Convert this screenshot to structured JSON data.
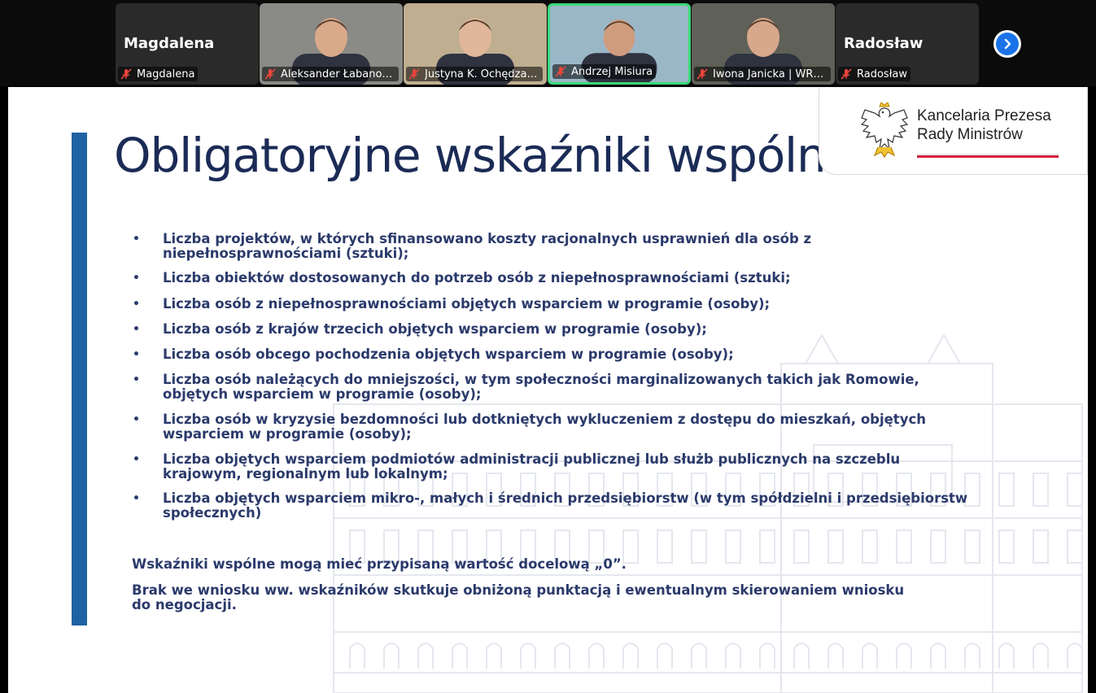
{
  "participants": [
    {
      "big_name": "Magdalena",
      "label": "Magdalena",
      "video": false,
      "active": false
    },
    {
      "big_name": "",
      "label": "Aleksander Łabanowsk...",
      "video": true,
      "active": false
    },
    {
      "big_name": "",
      "label": "Justyna K. Ochędzan W...",
      "video": true,
      "active": false
    },
    {
      "big_name": "",
      "label": "Andrzej Misiura",
      "video": true,
      "active": true
    },
    {
      "big_name": "",
      "label": "Iwona Janicka | WRZOS",
      "video": true,
      "active": false
    },
    {
      "big_name": "Radosław",
      "label": "Radosław",
      "video": false,
      "active": false
    }
  ],
  "icons": {
    "muted": "microphone-muted-icon",
    "next": "chevron-right-icon",
    "emblem": "polish-eagle-emblem-icon"
  },
  "slide": {
    "title": "Obligatoryjne wskaźniki wspólne",
    "logo_line1": "Kancelaria Prezesa",
    "logo_line2": "Rady Ministrów",
    "bullets": [
      "Liczba projektów, w których sfinansowano koszty racjonalnych usprawnień dla osób z niepełnosprawnościami (sztuki);",
      "Liczba obiektów dostosowanych do potrzeb osób z niepełnosprawnościami (sztuki;",
      "Liczba osób z niepełnosprawnościami objętych wsparciem w programie (osoby);",
      "Liczba osób z krajów trzecich objętych wsparciem w programie (osoby);",
      "Liczba osób obcego pochodzenia objętych wsparciem w programie (osoby);",
      "Liczba osób należących do mniejszości, w tym społeczności marginalizowanych takich jak Romowie, objętych wsparciem w programie (osoby);",
      "Liczba osób w kryzysie bezdomności lub dotkniętych wykluczeniem z dostępu do mieszkań, objętych wsparciem w programie (osoby);",
      "Liczba objętych wsparciem podmiotów administracji publicznej lub służb publicznych na szczeblu krajowym, regionalnym lub lokalnym;",
      "Liczba objętych wsparciem mikro-, małych i średnich przedsiębiorstw (w tym spółdzielni i przedsiębiorstw społecznych)"
    ],
    "note1": "Wskaźniki wspólne mogą mieć przypisaną wartość docelową „0”.",
    "note2": "Brak we wniosku ww. wskaźników skutkuje obniżoną punktacją i ewentualnym skierowaniem wniosku do negocjacji."
  },
  "colors": {
    "accent_bar": "#1f63a3",
    "title": "#1b2b56",
    "text": "#2b3a6b",
    "active_tile_border": "#3bd97a",
    "next_button": "#1a73e8",
    "muted_icon": "#e8453c",
    "flag_red": "#d4213d"
  }
}
